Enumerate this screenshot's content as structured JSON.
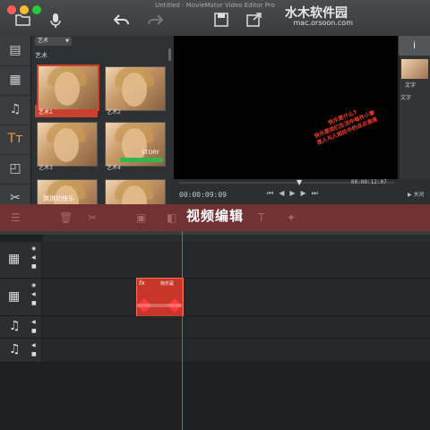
{
  "window": {
    "title": "Untitled - MovieMator Video Editor Pro"
  },
  "watermark": {
    "brand": "水木软件园",
    "url": "mac.orsoon.com"
  },
  "toolbar": {
    "icons": [
      "folder-open-icon",
      "microphone-icon",
      "undo-icon",
      "redo-icon",
      "save-icon",
      "export-icon"
    ]
  },
  "sidebar": {
    "items": [
      {
        "name": "media",
        "glyph": "▤"
      },
      {
        "name": "video-effects",
        "glyph": "▦"
      },
      {
        "name": "audio",
        "glyph": "♫"
      },
      {
        "name": "text",
        "glyph": "Tт"
      },
      {
        "name": "transitions",
        "glyph": "◰"
      },
      {
        "name": "filters",
        "glyph": "✂"
      }
    ]
  },
  "library": {
    "dropdown_value": "艺术",
    "category": "艺术",
    "items": [
      {
        "label": "艺术1",
        "selected": true
      },
      {
        "label": "艺术2",
        "selected": false
      },
      {
        "label": "艺术3",
        "selected": false
      },
      {
        "label": "艺术4",
        "selected": false
      },
      {
        "label": "",
        "selected": false
      },
      {
        "label": "",
        "selected": false
      }
    ],
    "thumb_captions": [
      "",
      "",
      "",
      "",
      "",
      "STORY",
      ""
    ],
    "partial_caption": "琪琪的快乐"
  },
  "preview": {
    "overlay_lines": [
      "快乐是什么?",
      "快乐是我们生活中每件小事",
      "是人与人相处中的点点滴滴"
    ],
    "current_time": "00:00:09:09",
    "total_time": "00:00:12:07"
  },
  "properties": {
    "info_glyph": "i",
    "item_label": "文字",
    "section_label": "文字",
    "close_label": "关闭"
  },
  "banner": {
    "text": "视频编辑"
  },
  "timeline": {
    "tracks": [
      {
        "type": "video",
        "glyph": "▦"
      },
      {
        "type": "video",
        "glyph": "▦"
      },
      {
        "type": "audio",
        "glyph": "♫"
      },
      {
        "type": "audio",
        "glyph": "♫"
      }
    ],
    "clip": {
      "badge": "fx",
      "title": "快乐是"
    }
  },
  "colors": {
    "accent": "#c9402e",
    "playhead": "#e04040"
  }
}
